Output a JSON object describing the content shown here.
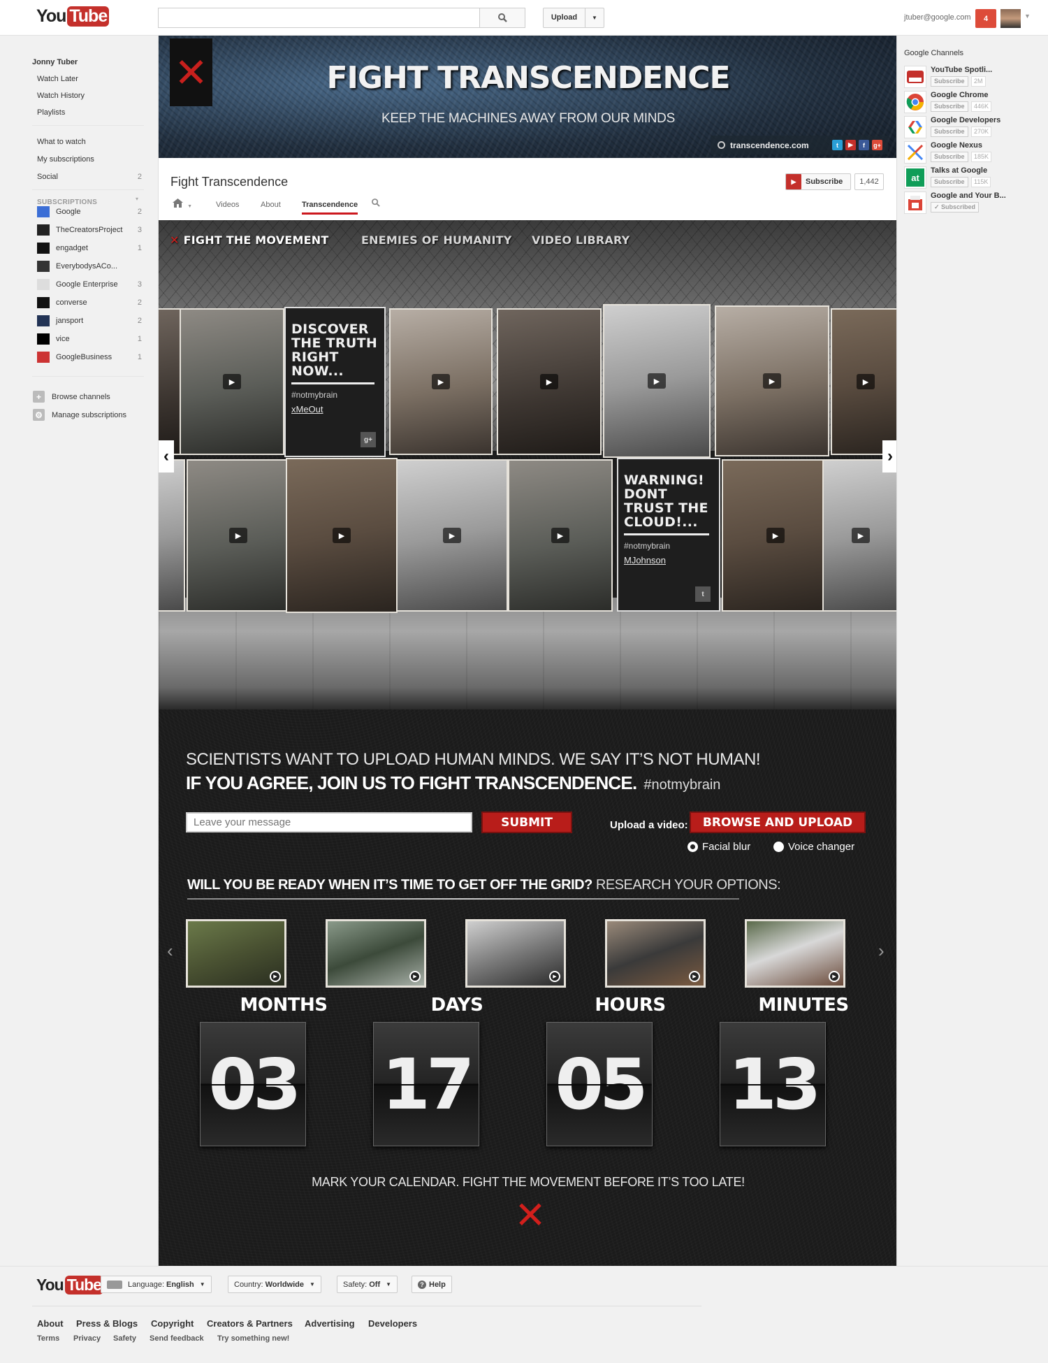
{
  "topbar": {
    "logo_you": "You",
    "logo_tube": "Tube",
    "search_placeholder": "",
    "upload_label": "Upload",
    "account": "jtuber@google.com",
    "notifications": "4"
  },
  "leftnav": {
    "user": "Jonny Tuber",
    "items": [
      "Watch Later",
      "Watch History",
      "Playlists"
    ],
    "items2": [
      "What to watch",
      "My subscriptions",
      "Social"
    ],
    "social_count": "2",
    "subs_heading": "SUBSCRIPTIONS",
    "subscriptions": [
      {
        "name": "Google",
        "count": "2",
        "color": "#3b6ed6"
      },
      {
        "name": "TheCreatorsProject",
        "count": "3",
        "color": "#222222"
      },
      {
        "name": "engadget",
        "count": "1",
        "color": "#111111"
      },
      {
        "name": "EverybodysACo...",
        "count": "",
        "color": "#333333"
      },
      {
        "name": "Google Enterprise",
        "count": "3",
        "color": "#dddddd"
      },
      {
        "name": "converse",
        "count": "2",
        "color": "#111111"
      },
      {
        "name": "jansport",
        "count": "2",
        "color": "#223355"
      },
      {
        "name": "vice",
        "count": "1",
        "color": "#000000"
      },
      {
        "name": "GoogleBusiness",
        "count": "1",
        "color": "#cc3333"
      }
    ],
    "browse": "Browse channels",
    "manage": "Manage subscriptions"
  },
  "banner": {
    "logo_glyph": "✕",
    "title": "FIGHT TRANSCENDENCE",
    "subtitle": "KEEP THE MACHINES AWAY FROM OUR MINDS",
    "link": "transcendence.com"
  },
  "channel": {
    "name": "Fight Transcendence",
    "subscribe": "Subscribe",
    "subscriber_count": "1,442",
    "tabs": [
      "Videos",
      "About",
      "Transcendence"
    ]
  },
  "app": {
    "nav": [
      "FIGHT THE MOVEMENT",
      "ENEMIES OF HUMANITY",
      "VIDEO LIBRARY"
    ],
    "card1": {
      "headline": "DISCOVER THE TRUTH RIGHT NOW...",
      "tag": "#notmybrain",
      "user": "xMeOut",
      "badge": "g+"
    },
    "card2": {
      "headline": "WARNING! DONT TRUST THE CLOUD!...",
      "tag": "#notmybrain",
      "user": "MJohnson",
      "badge": "t"
    },
    "pitch_line1": "SCIENTISTS WANT TO UPLOAD HUMAN MINDS. WE SAY IT’S NOT HUMAN!",
    "pitch_line2": "IF YOU AGREE, JOIN US TO FIGHT TRANSCENDENCE.",
    "pitch_tag": "#notmybrain",
    "message_placeholder": "Leave your message",
    "submit": "SUBMIT",
    "upload_label": "Upload a video:",
    "browse_upload": "BROWSE AND UPLOAD",
    "options": [
      "Facial blur",
      "Voice changer"
    ],
    "selected_option": "Facial blur",
    "grid_question": "WILL YOU BE READY WHEN IT’S TIME TO GET OFF THE GRID?",
    "grid_research": "RESEARCH YOUR OPTIONS:",
    "countdown": [
      {
        "label": "MONTHS",
        "value": "03"
      },
      {
        "label": "DAYS",
        "value": "17"
      },
      {
        "label": "HOURS",
        "value": "05"
      },
      {
        "label": "MINUTES",
        "value": "13"
      }
    ],
    "mark": "MARK YOUR CALENDAR. FIGHT THE MOVEMENT BEFORE IT’S TOO LATE!"
  },
  "rightcol": {
    "heading": "Google Channels",
    "channels": [
      {
        "name": "YouTube Spotli...",
        "action": "Subscribe",
        "count": "2M"
      },
      {
        "name": "Google Chrome",
        "action": "Subscribe",
        "count": "446K"
      },
      {
        "name": "Google Developers",
        "action": "Subscribe",
        "count": "270K"
      },
      {
        "name": "Google Nexus",
        "action": "Subscribe",
        "count": "185K"
      },
      {
        "name": "Talks at Google",
        "action": "Subscribe",
        "count": "115K"
      },
      {
        "name": "Google and Your B...",
        "action": "✓ Subscribed",
        "count": ""
      }
    ]
  },
  "footer": {
    "language_label": "Language:",
    "language": "English",
    "country_label": "Country:",
    "country": "Worldwide",
    "safety_label": "Safety:",
    "safety": "Off",
    "help": "Help",
    "links1": [
      "About",
      "Press & Blogs",
      "Copyright",
      "Creators & Partners",
      "Advertising",
      "Developers"
    ],
    "links2": [
      "Terms",
      "Privacy",
      "Safety",
      "Send feedback",
      "Try something new!"
    ]
  },
  "colors": {
    "brand_red": "#c4302b",
    "accent_red": "#cc181e",
    "campaign_red": "#d21f1c"
  }
}
